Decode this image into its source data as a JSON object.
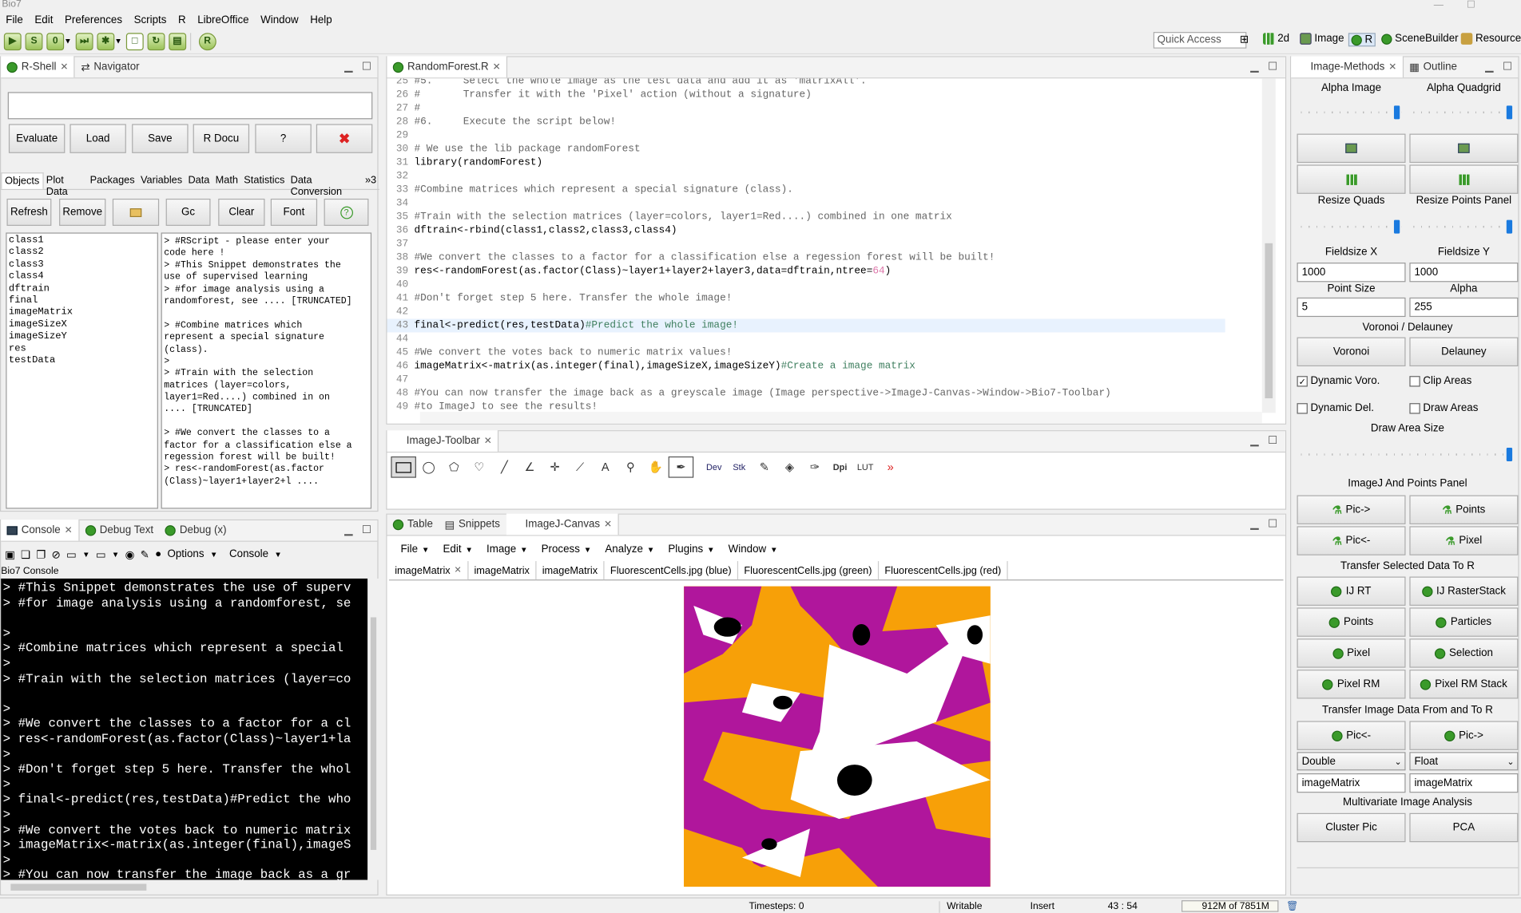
{
  "window_title": "Bio7",
  "menu": [
    "File",
    "Edit",
    "Preferences",
    "Scripts",
    "R",
    "LibreOffice",
    "Window",
    "Help"
  ],
  "quick_access": "Quick Access",
  "perspectives": [
    "2d",
    "Image",
    "R",
    "SceneBuilder",
    "Resource"
  ],
  "rshell": {
    "tabs": [
      "R-Shell",
      "Navigator"
    ],
    "buttons": [
      "Evaluate",
      "Load",
      "Save",
      "R Docu",
      "?"
    ],
    "subtabs": [
      "Objects",
      "Plot Data",
      "Packages",
      "Variables",
      "Data",
      "Math",
      "Statistics",
      "Data Conversion",
      "»3"
    ],
    "buttons2": [
      "Refresh",
      "Remove",
      "Gc",
      "Clear",
      "Font"
    ],
    "objects": [
      "class1",
      "class2",
      "class3",
      "class4",
      "dftrain",
      "final",
      "imageMatrix",
      "imageSizeX",
      "imageSizeY",
      "res",
      "testData"
    ],
    "script_lines": [
      "> #RScript - please enter your",
      "code here !",
      "> #This Snippet demonstrates the",
      "use of supervised learning",
      "> #for image analysis using a",
      "randomforest, see .... [TRUNCATED]",
      "",
      "> #Combine matrices which",
      "represent a special signature",
      "(class).",
      ">",
      "> #Train with the selection",
      "matrices (layer=colors,",
      "layer1=Red....) combined in on",
      ".... [TRUNCATED]",
      "",
      "> #We convert the classes to a",
      "factor for a classification else a",
      "regession forest will be built!",
      "> res<-randomForest(as.factor",
      "(Class)~layer1+layer2+l ...."
    ]
  },
  "editor": {
    "tab": "RandomForest.R",
    "lines": [
      {
        "n": "25",
        "t": "#5.     Select the whole image as the test data and add it as 'matrixAll'.",
        "c": "cm2"
      },
      {
        "n": "26",
        "t": "#       Transfer it with the 'Pixel' action (without a signature)",
        "c": "cm2"
      },
      {
        "n": "27",
        "t": "#",
        "c": "cm2"
      },
      {
        "n": "28",
        "t": "#6.     Execute the script below!",
        "c": "cm2"
      },
      {
        "n": "29",
        "t": "",
        "c": ""
      },
      {
        "n": "30",
        "t": "# We use the lib package randomForest",
        "c": "cm2"
      },
      {
        "n": "31",
        "t": "library(randomForest)",
        "c": "kw"
      },
      {
        "n": "32",
        "t": "",
        "c": ""
      },
      {
        "n": "33",
        "t": "#Combine matrices which represent a special signature (class).",
        "c": "cm2"
      },
      {
        "n": "34",
        "t": "",
        "c": ""
      },
      {
        "n": "35",
        "t": "#Train with the selection matrices (layer=colors, layer1=Red....) combined in one matrix",
        "c": "cm2"
      },
      {
        "n": "36",
        "t": "dftrain<-rbind(class1,class2,class3,class4)",
        "c": "kw"
      },
      {
        "n": "37",
        "t": "",
        "c": ""
      },
      {
        "n": "38",
        "t": "#We convert the classes to a factor for a classification else a regession forest will be built!",
        "c": "cm2"
      },
      {
        "n": "39",
        "t": "res<-randomForest(as.factor(Class)~layer1+layer2+layer3,data=dftrain,ntree=",
        "c": "kw",
        "tail": "64",
        "tail2": ")"
      },
      {
        "n": "40",
        "t": "",
        "c": ""
      },
      {
        "n": "41",
        "t": "#Don't forget step 5 here. Transfer the whole image!",
        "c": "cm2"
      },
      {
        "n": "42",
        "t": "",
        "c": ""
      },
      {
        "n": "43",
        "t": "final<-predict(res,testData)",
        "c": "kw",
        "tail": "#Predict the whole image!",
        "hl": true
      },
      {
        "n": "44",
        "t": "",
        "c": ""
      },
      {
        "n": "45",
        "t": "#We convert the votes back to numeric matrix values!",
        "c": "cm2"
      },
      {
        "n": "46",
        "t": "imageMatrix<-matrix(as.integer(final),imageSizeX,imageSizeY)",
        "c": "kw",
        "tail": "#Create a image matrix"
      },
      {
        "n": "47",
        "t": "",
        "c": ""
      },
      {
        "n": "48",
        "t": "#You can now transfer the image back as a greyscale image (Image perspective->ImageJ-Canvas->Window->Bio7-Toolbar)",
        "c": "cm2"
      },
      {
        "n": "49",
        "t": "#to ImageJ to see the results!",
        "c": "cm2"
      }
    ]
  },
  "ij_toolbar": {
    "tab": "ImageJ-Toolbar",
    "labels": [
      "Dev",
      "Stk",
      "Dpi",
      "LUT"
    ]
  },
  "canvas": {
    "tabs": [
      "Table",
      "Snippets",
      "ImageJ-Canvas"
    ],
    "menu": [
      "File",
      "Edit",
      "Image",
      "Process",
      "Analyze",
      "Plugins",
      "Window"
    ],
    "image_tabs": [
      "imageMatrix",
      "imageMatrix",
      "imageMatrix",
      "FluorescentCells.jpg (blue)",
      "FluorescentCells.jpg (green)",
      "FluorescentCells.jpg (red)"
    ]
  },
  "console": {
    "tabs": [
      "Console",
      "Debug Text",
      "Debug (x)"
    ],
    "options": "Options",
    "console_label": "Console",
    "title": "Bio7 Console",
    "lines": [
      "> #This Snippet demonstrates the use of superv",
      "> #for image analysis using a randomforest, se",
      "",
      ">",
      "> #Combine matrices which represent a special",
      ">",
      "> #Train with the selection matrices (layer=co",
      "",
      ">",
      "> #We convert the classes to a factor for a cl",
      "> res<-randomForest(as.factor(Class)~layer1+la",
      ">",
      "> #Don't forget step 5 here. Transfer the whol",
      ">",
      "> final<-predict(res,testData)#Predict the who",
      ">",
      "> #We convert the votes back to numeric matrix",
      "> imageMatrix<-matrix(as.integer(final),imageS",
      ">",
      "> #You can now transfer the image back as a gr",
      "> #to ImageJ to see the results!"
    ]
  },
  "methods": {
    "tabs": [
      "Image-Methods",
      "Outline"
    ],
    "alpha_image": "Alpha Image",
    "alpha_quadgrid": "Alpha Quadgrid",
    "resize_quads": "Resize Quads",
    "resize_points": "Resize Points Panel",
    "fieldsize_x": "Fieldsize X",
    "fieldsize_y": "Fieldsize Y",
    "fx_val": "1000",
    "fy_val": "1000",
    "point_size": "Point Size",
    "alpha": "Alpha",
    "ps_val": "5",
    "alpha_val": "255",
    "voronoi_title": "Voronoi / Delauney",
    "voronoi": "Voronoi",
    "delauney": "Delauney",
    "dyn_voro": "Dynamic Voro.",
    "clip_areas": "Clip Areas",
    "dyn_del": "Dynamic Del.",
    "draw_areas": "Draw Areas",
    "draw_area_size": "Draw Area Size",
    "ij_points_panel": "ImageJ And Points Panel",
    "pic_to": "Pic->",
    "points": "Points",
    "pic_from": "Pic<-",
    "pixel": "Pixel",
    "transfer_sel": "Transfer Selected Data To R",
    "ij_rt": "IJ RT",
    "ij_rasterstack": "IJ RasterStack",
    "points2": "Points",
    "particles": "Particles",
    "pixel2": "Pixel",
    "selection": "Selection",
    "pixel_rm": "Pixel RM",
    "pixel_rm_stack": "Pixel RM Stack",
    "transfer_img": "Transfer Image Data From and To R",
    "pic_from2": "Pic<-",
    "pic_to2": "Pic->",
    "double": "Double",
    "float": "Float",
    "im1": "imageMatrix",
    "im2": "imageMatrix",
    "multivariate": "Multivariate Image Analysis",
    "cluster_pic": "Cluster Pic",
    "pca": "PCA"
  },
  "status": {
    "timesteps": "Timesteps: 0",
    "writable": "Writable",
    "insert": "Insert",
    "pos": "43 : 54",
    "mem": "912M of 7851M"
  },
  "colors": {
    "magenta": "#b0169c",
    "orange": "#f7a008",
    "green": "#3a9a2a",
    "blue": "#1a7adf"
  }
}
